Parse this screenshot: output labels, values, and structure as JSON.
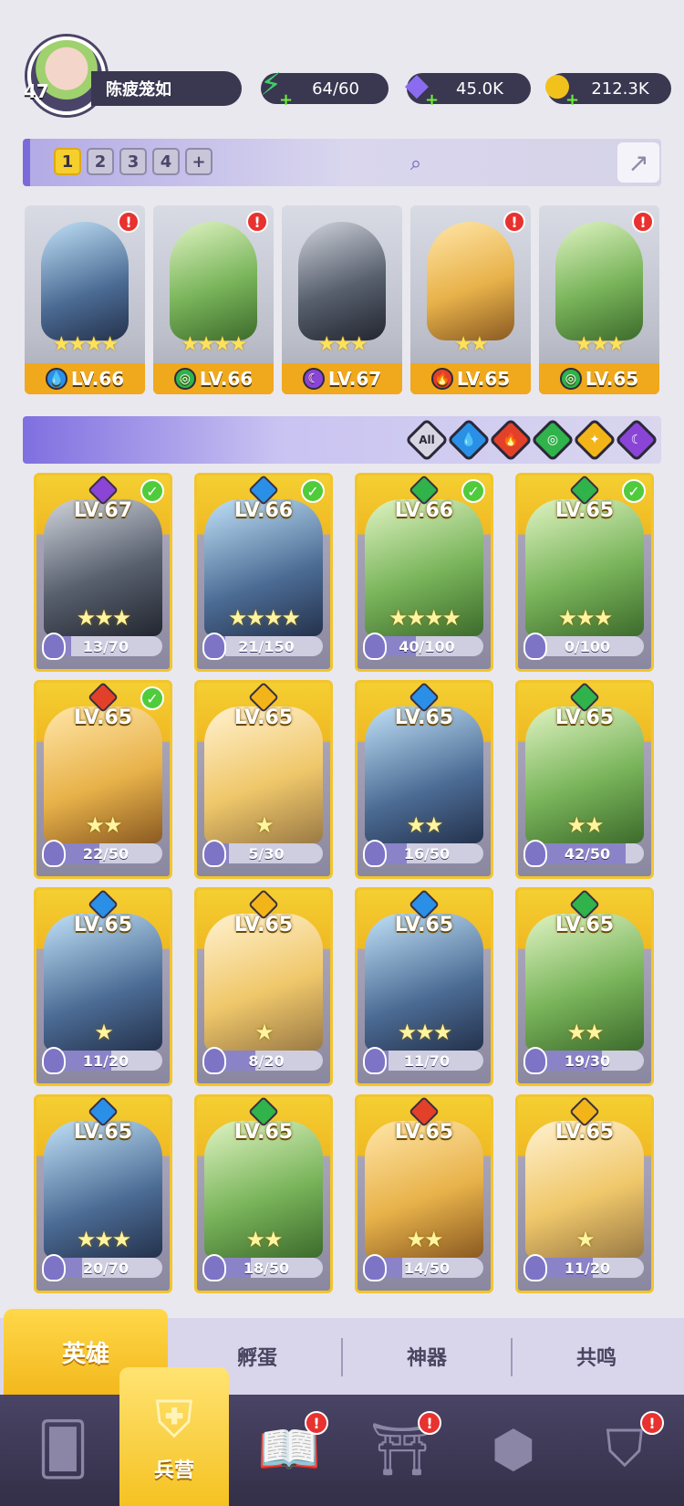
{
  "player": {
    "level": "47",
    "name": "陈疲笼如"
  },
  "resources": [
    {
      "name": "energy",
      "icon": "lightning-icon",
      "value": "64/60",
      "color": "#3fd06a"
    },
    {
      "name": "gems",
      "icon": "gem-icon",
      "value": "45.0K",
      "color": "#8b6cf0"
    },
    {
      "name": "gold",
      "icon": "coin-icon",
      "value": "212.3K",
      "color": "#f2c21c"
    }
  ],
  "team_slots": [
    "1",
    "2",
    "3",
    "4",
    "+"
  ],
  "active_team_slot": "1",
  "team": [
    {
      "level": "LV.66",
      "stars": "★★★★",
      "element": "water",
      "alert": "!"
    },
    {
      "level": "LV.66",
      "stars": "★★★★",
      "element": "nature",
      "alert": "!"
    },
    {
      "level": "LV.67",
      "stars": "★★★",
      "element": "dark",
      "alert": ""
    },
    {
      "level": "LV.65",
      "stars": "★★",
      "element": "fire",
      "alert": "!"
    },
    {
      "level": "LV.65",
      "stars": "★★★",
      "element": "nature",
      "alert": "!"
    }
  ],
  "filters": {
    "all_label": "All",
    "elements": [
      "water",
      "fire",
      "nature",
      "light",
      "dark"
    ]
  },
  "element_colors": {
    "water": "#2a8fe6",
    "fire": "#e3402a",
    "nature": "#2fb34a",
    "light": "#f2b418",
    "dark": "#8a44d6"
  },
  "heroes": [
    {
      "level": "LV.67",
      "element": "dark",
      "owned": true,
      "stars": "★★★",
      "shards": "13/70",
      "progress": 0.19
    },
    {
      "level": "LV.66",
      "element": "water",
      "owned": true,
      "stars": "★★★★",
      "shards": "21/150",
      "progress": 0.14
    },
    {
      "level": "LV.66",
      "element": "nature",
      "owned": true,
      "stars": "★★★★",
      "shards": "40/100",
      "progress": 0.4
    },
    {
      "level": "LV.65",
      "element": "nature",
      "owned": true,
      "stars": "★★★",
      "shards": "0/100",
      "progress": 0.0
    },
    {
      "level": "LV.65",
      "element": "fire",
      "owned": true,
      "stars": "★★",
      "shards": "22/50",
      "progress": 0.44
    },
    {
      "level": "LV.65",
      "element": "light",
      "owned": false,
      "stars": "★",
      "shards": "5/30",
      "progress": 0.17
    },
    {
      "level": "LV.65",
      "element": "water",
      "owned": false,
      "stars": "★★",
      "shards": "16/50",
      "progress": 0.32
    },
    {
      "level": "LV.65",
      "element": "nature",
      "owned": false,
      "stars": "★★",
      "shards": "42/50",
      "progress": 0.84
    },
    {
      "level": "LV.65",
      "element": "water",
      "owned": false,
      "stars": "★",
      "shards": "11/20",
      "progress": 0.55
    },
    {
      "level": "LV.65",
      "element": "light",
      "owned": false,
      "stars": "★",
      "shards": "8/20",
      "progress": 0.4
    },
    {
      "level": "LV.65",
      "element": "water",
      "owned": false,
      "stars": "★★★",
      "shards": "11/70",
      "progress": 0.16
    },
    {
      "level": "LV.65",
      "element": "nature",
      "owned": false,
      "stars": "★★",
      "shards": "19/30",
      "progress": 0.63
    },
    {
      "level": "LV.65",
      "element": "water",
      "owned": false,
      "stars": "★★★",
      "shards": "20/70",
      "progress": 0.29
    },
    {
      "level": "LV.65",
      "element": "nature",
      "owned": false,
      "stars": "★★",
      "shards": "18/50",
      "progress": 0.36
    },
    {
      "level": "LV.65",
      "element": "fire",
      "owned": false,
      "stars": "★★",
      "shards": "14/50",
      "progress": 0.28
    },
    {
      "level": "LV.65",
      "element": "light",
      "owned": false,
      "stars": "★",
      "shards": "11/20",
      "progress": 0.55
    }
  ],
  "tabs": [
    {
      "label": "英雄",
      "active": true
    },
    {
      "label": "孵蛋",
      "active": false
    },
    {
      "label": "神器",
      "active": false
    },
    {
      "label": "共鸣",
      "active": false
    }
  ],
  "nav": [
    {
      "name": "cards",
      "icon": "cards-icon",
      "label": "",
      "alert": ""
    },
    {
      "name": "barracks",
      "icon": "barracks-icon",
      "label": "兵营",
      "alert": "",
      "active": true
    },
    {
      "name": "quests",
      "icon": "book-icon",
      "label": "",
      "alert": "!"
    },
    {
      "name": "temple",
      "icon": "temple-icon",
      "label": "",
      "alert": "!"
    },
    {
      "name": "guild",
      "icon": "guild-icon",
      "label": "",
      "alert": ""
    },
    {
      "name": "banner",
      "icon": "banner-icon",
      "label": "",
      "alert": "!"
    }
  ]
}
